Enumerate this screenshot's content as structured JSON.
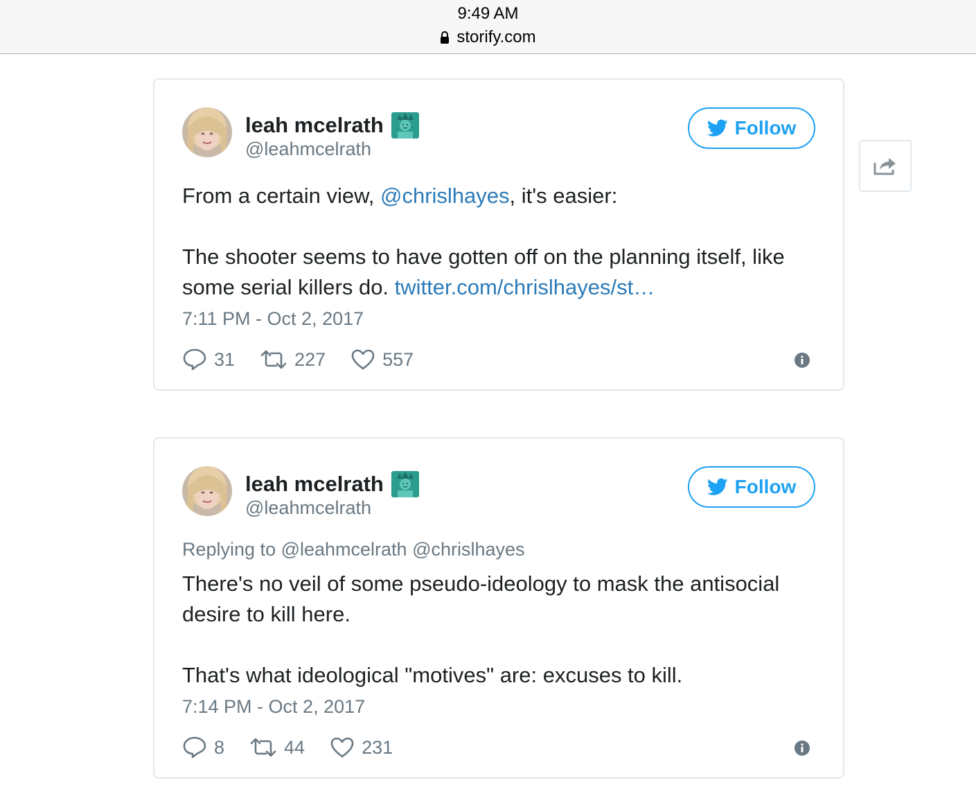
{
  "browser": {
    "time": "9:49 AM",
    "url": "storify.com"
  },
  "tweets": [
    {
      "author_name": "leah mcelrath",
      "handle": "@leahmcelrath",
      "follow_label": "Follow",
      "text_line1_prefix": "From a certain view, ",
      "text_line1_mention": "@chrislhayes",
      "text_line1_suffix": ", it's easier:",
      "text_para2": "The shooter seems to have gotten off on the planning itself, like some serial killers do. ",
      "text_para2_link": "twitter.com/chrislhayes/st…",
      "timestamp": "7:11 PM - Oct 2, 2017",
      "replies": "31",
      "retweets": "227",
      "likes": "557"
    },
    {
      "author_name": "leah mcelrath",
      "handle": "@leahmcelrath",
      "follow_label": "Follow",
      "reply_to": "Replying to @leahmcelrath @chrislhayes",
      "text_para1": "There's no veil of some pseudo-ideology to mask the antisocial desire to kill here.",
      "text_para2": "That's what ideological \"motives\" are: excuses to kill.",
      "timestamp": "7:14 PM - Oct 2, 2017",
      "replies": "8",
      "retweets": "44",
      "likes": "231"
    }
  ],
  "colors": {
    "twitter_blue": "#1da1f2",
    "link_blue": "#2b7bb9",
    "muted_gray": "#697882",
    "border": "#e1e8ed"
  },
  "icons": [
    "lock-icon",
    "statue-of-liberty-icon",
    "twitter-bird-icon",
    "reply-icon",
    "retweet-icon",
    "heart-icon",
    "info-icon",
    "share-icon"
  ]
}
